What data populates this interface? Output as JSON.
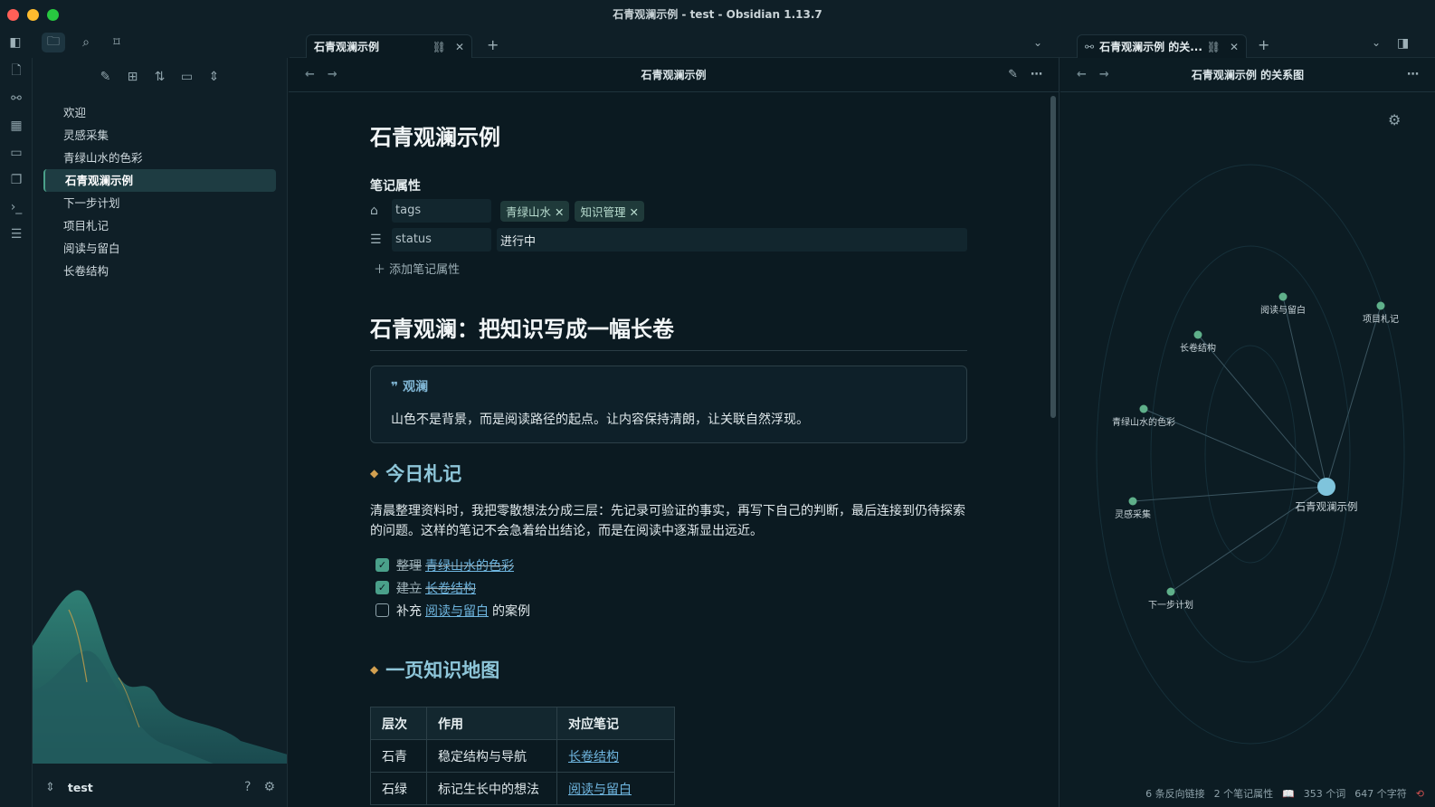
{
  "window": {
    "title": "石青观澜示例 - test - Obsidian 1.13.7"
  },
  "tabs": {
    "main": {
      "label": "石青观澜示例"
    },
    "graph": {
      "label": "石青观澜示例 的关..."
    }
  },
  "explorer": {
    "files": [
      "欢迎",
      "灵感采集",
      "青绿山水的色彩",
      "石青观澜示例",
      "下一步计划",
      "项目札记",
      "阅读与留白",
      "长卷结构"
    ],
    "active_index": 3,
    "vault_name": "test"
  },
  "editor": {
    "header_title": "石青观澜示例",
    "doc_title": "石青观澜示例",
    "properties": {
      "heading": "笔记属性",
      "tags_key": "tags",
      "tags": [
        "青绿山水",
        "知识管理"
      ],
      "status_key": "status",
      "status_value": "进行中",
      "add_label": "添加笔记属性"
    },
    "h1": "石青观澜：把知识写成一幅长卷",
    "callout": {
      "title": "观澜",
      "body": "山色不是背景，而是阅读路径的起点。让内容保持清朗，让关联自然浮现。"
    },
    "section1": {
      "heading": "今日札记",
      "paragraph": "清晨整理资料时，我把零散想法分成三层：先记录可验证的事实，再写下自己的判断，最后连接到仍待探索的问题。这样的笔记不会急着给出结论，而是在阅读中逐渐显出远近。",
      "tasks": [
        {
          "prefix": "整理",
          "link": "青绿山水的色彩",
          "suffix": "",
          "done": true
        },
        {
          "prefix": "建立",
          "link": "长卷结构",
          "suffix": "",
          "done": true
        },
        {
          "prefix": "补充",
          "link": "阅读与留白",
          "suffix": "的案例",
          "done": false
        }
      ]
    },
    "section2": {
      "heading": "一页知识地图",
      "table": {
        "headers": [
          "层次",
          "作用",
          "对应笔记"
        ],
        "rows": [
          [
            "石青",
            "稳定结构与导航",
            "长卷结构"
          ],
          [
            "石绿",
            "标记生长中的想法",
            "阅读与留白"
          ]
        ]
      }
    }
  },
  "graph": {
    "header_title": "石青观澜示例 的关系图",
    "nodes": [
      {
        "label": "阅读与留白"
      },
      {
        "label": "项目札记"
      },
      {
        "label": "长卷结构"
      },
      {
        "label": "青绿山水的色彩"
      },
      {
        "label": "灵感采集"
      },
      {
        "label": "石青观澜示例"
      },
      {
        "label": "下一步计划"
      }
    ],
    "status": {
      "backlinks": "6 条反向链接",
      "props": "2 个笔记属性",
      "words": "353 个词",
      "chars": "647 个字符"
    }
  },
  "colors": {
    "accent": "#4aa08a",
    "link": "#6fb6e0",
    "heading": "#8ec6d9",
    "node": "#5fb08a",
    "current_node": "#7fc4dc"
  }
}
